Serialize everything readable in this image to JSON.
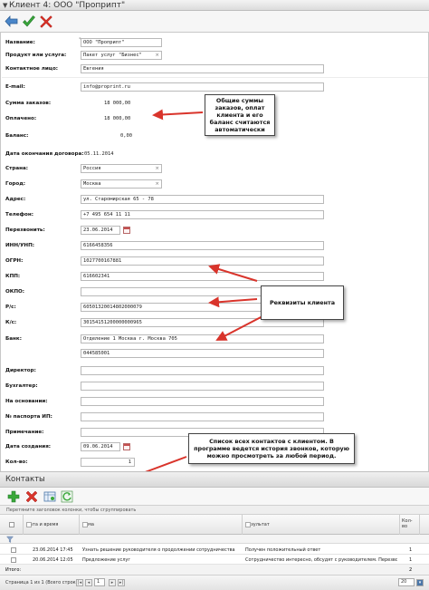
{
  "window": {
    "title": "Клиент 4: ООО \"Проприпт\""
  },
  "toolbar": {
    "back_icon": "back-arrow-icon",
    "save_icon": "checkmark-icon",
    "cancel_icon": "close-icon"
  },
  "form": {
    "name": {
      "label": "Название:",
      "value": "ООО \"Проприпт\""
    },
    "product": {
      "label": "Продукт или услуга:",
      "value": "Пакет услуг \"Бизнес\""
    },
    "contact": {
      "label": "Контактное лицо:",
      "value": "Евгения"
    },
    "email": {
      "label": "E-mail:",
      "value": "info@proprint.ru"
    },
    "orders_sum": {
      "label": "Сумма заказов:",
      "value": "18 000,00"
    },
    "paid": {
      "label": "Оплачено:",
      "value": "18 000,00"
    },
    "balance": {
      "label": "Баланс:",
      "value": "0,00"
    },
    "contract_end": {
      "label": "Дата окончания договора:",
      "value": "05.11.2014"
    },
    "country": {
      "label": "Страна:",
      "value": "Россия"
    },
    "city": {
      "label": "Город:",
      "value": "Москва"
    },
    "address": {
      "label": "Адрес:",
      "value": "ул. Старомирская 65 - 78"
    },
    "phone": {
      "label": "Телефон:",
      "value": "+7 495 654 11 11"
    },
    "callback": {
      "label": "Перезвонить:",
      "value": "23.06.2014"
    },
    "inn": {
      "label": "ИНН/УНП:",
      "value": "6166458356"
    },
    "ogrn": {
      "label": "ОГРН:",
      "value": "1027700167881"
    },
    "kpp": {
      "label": "КПП:",
      "value": "616602341"
    },
    "okpo": {
      "label": "ОКПО:",
      "value": ""
    },
    "rs": {
      "label": "Р/с:",
      "value": "60501320014802000079"
    },
    "ks": {
      "label": "К/с:",
      "value": "30154151200000000965"
    },
    "bank": {
      "label": "Банк:",
      "value": "Отделение 1 Москва г. Москва 705",
      "bik": "044585001"
    },
    "director": {
      "label": "Директор:",
      "value": ""
    },
    "accountant": {
      "label": "Бухгалтер:",
      "value": ""
    },
    "basis": {
      "label": "На основании:",
      "value": ""
    },
    "ip_passport": {
      "label": "№ паспорта ИП:",
      "value": ""
    },
    "note": {
      "label": "Примечание:",
      "value": ""
    },
    "created": {
      "label": "Дата создания:",
      "value": "09.06.2014"
    },
    "count": {
      "label": "Кол-во:",
      "value": "1"
    }
  },
  "callouts": {
    "sums": "Общие суммы заказов, оплат клиента и его баланс считаются автоматически",
    "requisites": "Реквизиты клиента",
    "contacts": "Список всех контактов с клиентом. В программе ведется история звонков, которую можно просмотреть за любой период."
  },
  "contacts": {
    "section_title": "Контакты",
    "group_hint": "Перетяните заголовок колонки, чтобы сгруппировать",
    "columns": [
      "Дата и время",
      "Тема",
      "Результат",
      "Кол-во"
    ],
    "rows": [
      {
        "date": "23.06.2014 17:45",
        "topic": "Узнать решение руководителя о продолжении сотрудничества",
        "result": "Получен положительный ответ",
        "count": "1"
      },
      {
        "date": "20.06.2014 12:05",
        "topic": "Предложение услуг",
        "result": "Сотрудничество интересно, обсудят с руководителем. Перезвонить",
        "count": "1"
      }
    ],
    "total_label": "Итого:",
    "total_value": "2",
    "pager": {
      "page_text": "Страница 1 из 1 (Всего строк: 2)",
      "current_page": "1",
      "page_size": "20"
    }
  },
  "colors": {
    "accent_arrow": "#d9342b",
    "save_green": "#3aa83a",
    "cancel_red": "#d9342b"
  }
}
